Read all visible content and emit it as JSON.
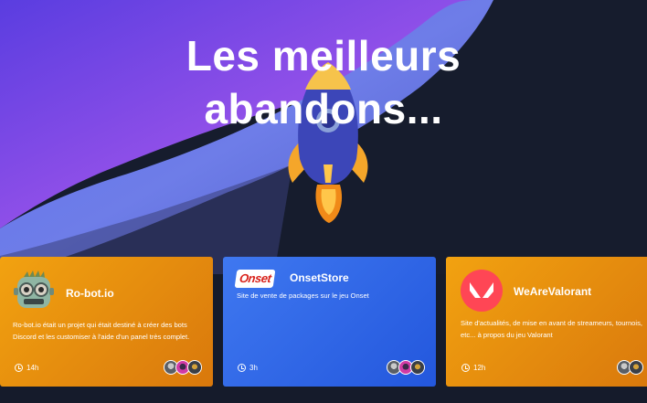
{
  "hero": {
    "line1": "Les meilleurs",
    "line2": "abandons..."
  },
  "cards": [
    {
      "name": "Ro-bot.io",
      "description": "Ro-bot.io était un projet qui était destiné à créer des bots Discord et les customiser à l'aide d'un panel très complet.",
      "duration": "14h",
      "logo_icon": "robot-icon"
    },
    {
      "name": "OnsetStore",
      "logo_text": "Onset",
      "description": "Site de vente de packages sur le jeu Onset",
      "duration": "3h",
      "logo_icon": "onset-logo"
    },
    {
      "name": "WeAreValorant",
      "description": "Site d'actualités, de mise en avant de streameurs, tournois, etc... à propos du jeu Valorant",
      "duration": "12h",
      "logo_icon": "valorant-logo-icon"
    }
  ],
  "colors": {
    "orange": "#e5890e",
    "blue": "#2f66e8",
    "background": "#151b2b"
  }
}
